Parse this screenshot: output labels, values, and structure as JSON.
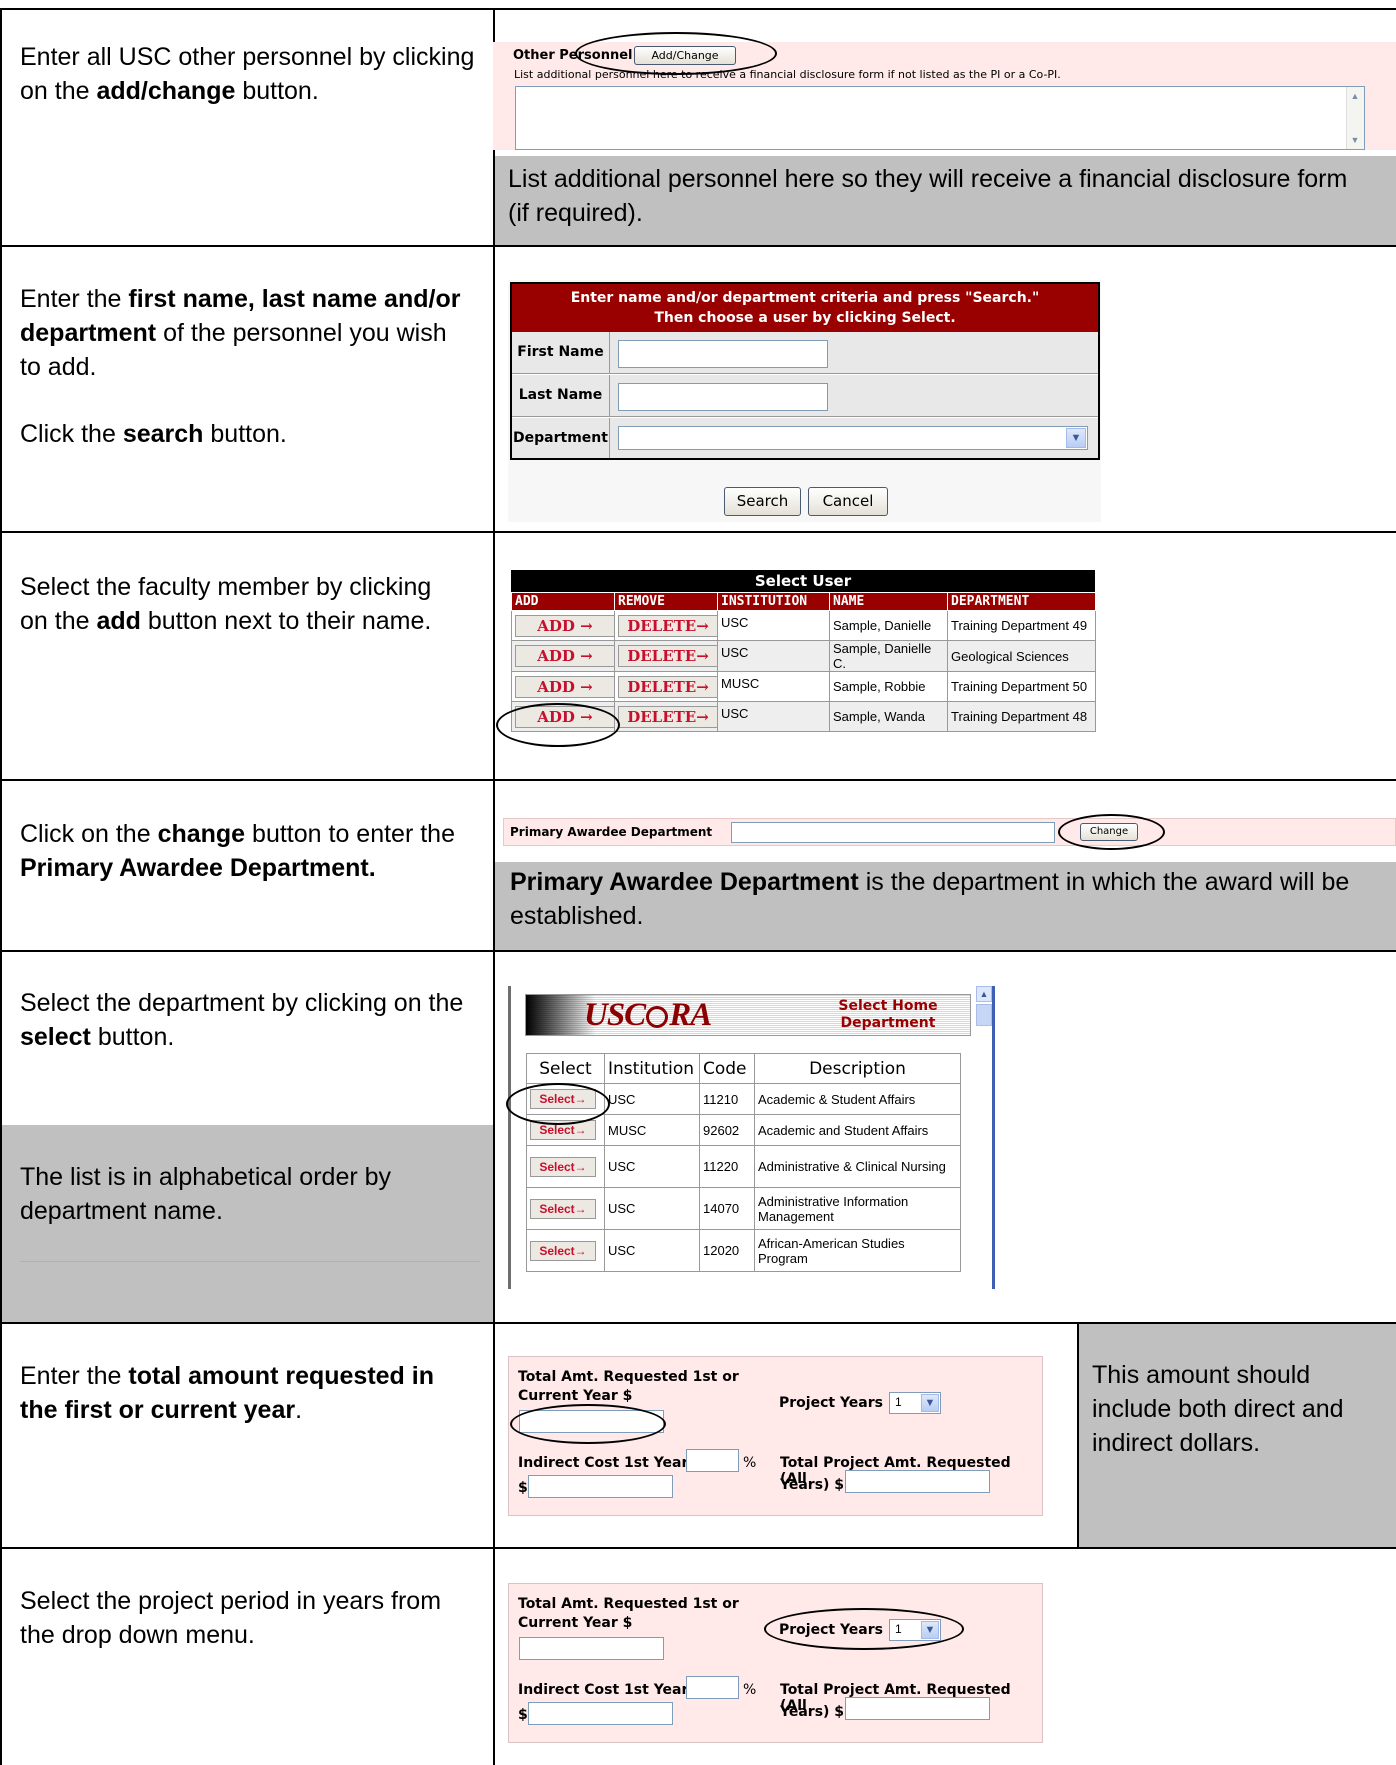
{
  "rows": [
    {
      "left": [
        {
          "t": "Enter all USC other personnel by clicking on the "
        },
        {
          "t": "add/change",
          "b": true
        },
        {
          "t": " button."
        }
      ],
      "shot": {
        "label": "Other Personnel",
        "button": "Add/Change",
        "help": "List additional personnel here to receive a financial disclosure form if not listed as the PI or a Co-PI."
      },
      "caption": "List additional personnel here so they will receive a financial disclosure form (if required)."
    },
    {
      "left_p1": [
        {
          "t": "Enter the "
        },
        {
          "t": "first name, last name and/or department",
          "b": true
        },
        {
          "t": " of the personnel you wish to add."
        }
      ],
      "left_p2": [
        {
          "t": "Click the "
        },
        {
          "t": "search",
          "b": true
        },
        {
          "t": " button."
        }
      ],
      "shot": {
        "header_line1": "Enter name and/or department criteria and press \"Search.\"",
        "header_line2": "Then choose a user by clicking Select.",
        "first_name_label": "First Name",
        "last_name_label": "Last Name",
        "department_label": "Department",
        "search_button": "Search",
        "cancel_button": "Cancel"
      }
    },
    {
      "left": [
        {
          "t": "Select the faculty member by clicking on the "
        },
        {
          "t": "add",
          "b": true
        },
        {
          "t": " button next to their name."
        }
      ],
      "shot": {
        "title": "Select User",
        "headers": [
          "ADD",
          "REMOVE",
          "INSTITUTION",
          "NAME",
          "DEPARTMENT"
        ],
        "add_label": "ADD →",
        "delete_label": "DELETE→",
        "users": [
          {
            "institution": "USC",
            "name": "Sample, Danielle",
            "department": "Training Department 49"
          },
          {
            "institution": "USC",
            "name": "Sample, Danielle C.",
            "department": "Geological Sciences"
          },
          {
            "institution": "MUSC",
            "name": "Sample, Robbie",
            "department": "Training Department 50"
          },
          {
            "institution": "USC",
            "name": "Sample, Wanda",
            "department": "Training Department 48"
          }
        ]
      }
    },
    {
      "left": [
        {
          "t": "Click on the "
        },
        {
          "t": "change",
          "b": true
        },
        {
          "t": " button to enter the "
        },
        {
          "t": "Primary Awardee Department.",
          "b": true
        }
      ],
      "shot": {
        "label": "Primary Awardee Department",
        "button": "Change"
      },
      "caption": [
        {
          "t": "Primary Awardee Department",
          "b": true
        },
        {
          "t": " is the department in which the award will be established."
        }
      ]
    },
    {
      "left": [
        {
          "t": "Select the department by clicking on the "
        },
        {
          "t": "select",
          "b": true
        },
        {
          "t": " button."
        }
      ],
      "left_grey": "The list is in alphabetical order by department name.",
      "shot": {
        "logo": "USCⓇRA",
        "logo_prefix": "USC",
        "logo_suffix": "RA",
        "panel_title_line1": "Select Home",
        "panel_title_line2": "Department",
        "headers": [
          "Select",
          "Institution",
          "Code",
          "Description"
        ],
        "select_label": "Select→",
        "departments": [
          {
            "institution": "USC",
            "code": "11210",
            "description": "Academic & Student Affairs"
          },
          {
            "institution": "MUSC",
            "code": "92602",
            "description": "Academic and Student Affairs"
          },
          {
            "institution": "USC",
            "code": "11220",
            "description": "Administrative & Clinical Nursing"
          },
          {
            "institution": "USC",
            "code": "14070",
            "description": "Administrative Information Management"
          },
          {
            "institution": "USC",
            "code": "12020",
            "description": "African-American Studies Program"
          }
        ]
      }
    },
    {
      "left": [
        {
          "t": "Enter the "
        },
        {
          "t": "total amount requested in the first or current year",
          "b": true
        },
        {
          "t": "."
        }
      ],
      "note": "This amount should include both direct and indirect dollars.",
      "shot": {
        "total_label_line1": "Total Amt. Requested 1st or",
        "total_label_line2": "Current Year $",
        "project_years_label": "Project Years",
        "project_years_value": "1",
        "indirect_label": "Indirect Cost 1st Year",
        "percent": "%",
        "dollar": "$",
        "total_project_line1": "Total Project Amt. Requested (All",
        "total_project_line2": "Years) $"
      }
    },
    {
      "left": [
        {
          "t": "Select the project period in years from the drop down menu."
        }
      ],
      "shot": {
        "total_label_line1": "Total Amt. Requested 1st or",
        "total_label_line2": "Current Year $",
        "project_years_label": "Project Years",
        "project_years_value": "1",
        "indirect_label": "Indirect Cost 1st Year",
        "percent": "%",
        "dollar": "$",
        "total_project_line1": "Total Project Amt. Requested (All",
        "total_project_line2": "Years) $"
      }
    }
  ]
}
